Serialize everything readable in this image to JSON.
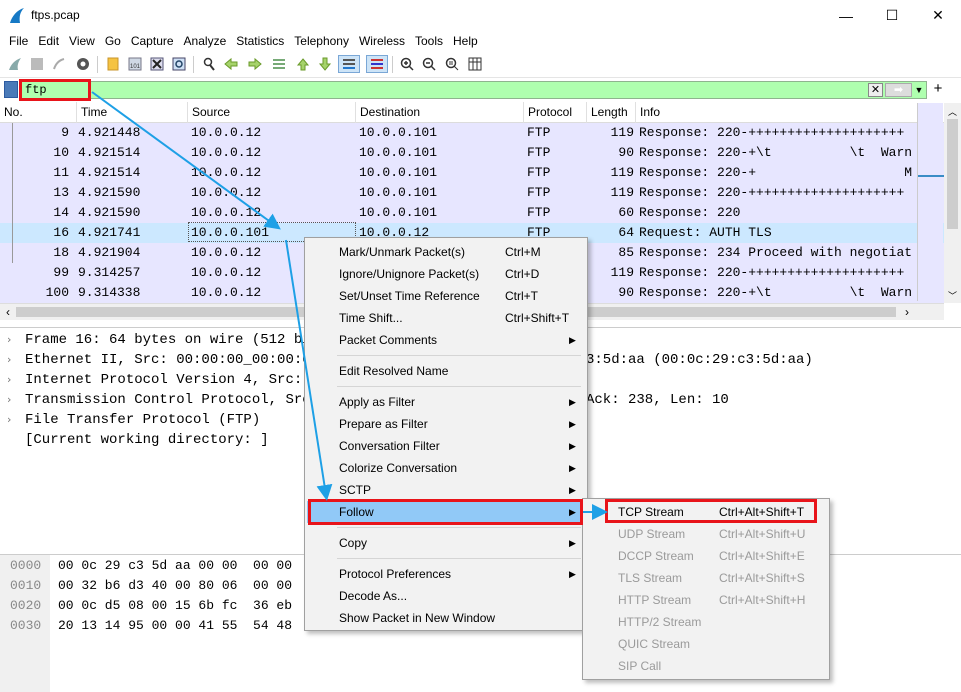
{
  "window": {
    "title": "ftps.pcap",
    "minimize": "—",
    "maximize": "☐",
    "close": "✕"
  },
  "menubar": [
    "File",
    "Edit",
    "View",
    "Go",
    "Capture",
    "Analyze",
    "Statistics",
    "Telephony",
    "Wireless",
    "Tools",
    "Help"
  ],
  "filter": {
    "value": "ftp",
    "plus": "+"
  },
  "columns": [
    "No.",
    "Time",
    "Source",
    "Destination",
    "Protocol",
    "Length",
    "Info"
  ],
  "packets": [
    {
      "no": "9",
      "time": "4.921448",
      "src": "10.0.0.12",
      "dst": "10.0.0.101",
      "proto": "FTP",
      "len": "119",
      "info": "Response: 220-++++++++++++++++++++"
    },
    {
      "no": "10",
      "time": "4.921514",
      "src": "10.0.0.12",
      "dst": "10.0.0.101",
      "proto": "FTP",
      "len": "90",
      "info": "Response: 220-+\\t          \\t  Warn"
    },
    {
      "no": "11",
      "time": "4.921514",
      "src": "10.0.0.12",
      "dst": "10.0.0.101",
      "proto": "FTP",
      "len": "119",
      "info": "Response: 220-+                   M"
    },
    {
      "no": "13",
      "time": "4.921590",
      "src": "10.0.0.12",
      "dst": "10.0.0.101",
      "proto": "FTP",
      "len": "119",
      "info": "Response: 220-++++++++++++++++++++"
    },
    {
      "no": "14",
      "time": "4.921590",
      "src": "10.0.0.12",
      "dst": "10.0.0.101",
      "proto": "FTP",
      "len": "60",
      "info": "Response: 220"
    },
    {
      "no": "16",
      "time": "4.921741",
      "src": "10.0.0.101",
      "dst": "10.0.0.12",
      "proto": "FTP",
      "len": "64",
      "info": "Request: AUTH TLS"
    },
    {
      "no": "18",
      "time": "4.921904",
      "src": "10.0.0.12",
      "dst": "",
      "proto": "",
      "len": "85",
      "info": "Response: 234 Proceed with negotiat"
    },
    {
      "no": "99",
      "time": "9.314257",
      "src": "10.0.0.12",
      "dst": "",
      "proto": "",
      "len": "119",
      "info": "Response: 220-++++++++++++++++++++"
    },
    {
      "no": "100",
      "time": "9.314338",
      "src": "10.0.0.12",
      "dst": "",
      "proto": "",
      "len": "90",
      "info": "Response: 220-+\\t          \\t  Warn"
    }
  ],
  "details": [
    {
      "text": "Frame 16: 64 bytes on wire (512 bit",
      "right": "",
      "expand": true
    },
    {
      "text": "Ethernet II, Src: 00:00:00_00:00:01",
      "right": "3:5d:aa (00:0c:29:c3:5d:aa)",
      "expand": true
    },
    {
      "text": "Internet Protocol Version 4, Src: 1",
      "right": "",
      "expand": true
    },
    {
      "text": "Transmission Control Protocol, Src",
      "right": "Ack: 238, Len: 10",
      "expand": true
    },
    {
      "text": "File Transfer Protocol (FTP)",
      "right": "",
      "expand": true
    },
    {
      "text": "[Current working directory: ]",
      "right": "",
      "expand": false
    }
  ],
  "bytes": [
    {
      "off": "0000",
      "hex": "00 0c 29 c3 5d aa 00 00  00 00"
    },
    {
      "off": "0010",
      "hex": "00 32 b6 d3 40 00 80 06  00 00"
    },
    {
      "off": "0020",
      "hex": "00 0c d5 08 00 15 6b fc  36 eb"
    },
    {
      "off": "0030",
      "hex": "20 13 14 95 00 00 41 55  54 48"
    }
  ],
  "context_menu": [
    {
      "label": "Mark/Unmark Packet(s)",
      "shortcut": "Ctrl+M"
    },
    {
      "label": "Ignore/Unignore Packet(s)",
      "shortcut": "Ctrl+D"
    },
    {
      "label": "Set/Unset Time Reference",
      "shortcut": "Ctrl+T"
    },
    {
      "label": "Time Shift...",
      "shortcut": "Ctrl+Shift+T"
    },
    {
      "label": "Packet Comments",
      "sub": "▶"
    },
    {
      "label": "Edit Resolved Name"
    },
    {
      "label": "Apply as Filter",
      "sub": "▶"
    },
    {
      "label": "Prepare as Filter",
      "sub": "▶"
    },
    {
      "label": "Conversation Filter",
      "sub": "▶"
    },
    {
      "label": "Colorize Conversation",
      "sub": "▶"
    },
    {
      "label": "SCTP",
      "sub": "▶"
    },
    {
      "label": "Follow",
      "sub": "▶"
    },
    {
      "label": "Copy",
      "sub": "▶"
    },
    {
      "label": "Protocol Preferences",
      "sub": "▶"
    },
    {
      "label": "Decode As..."
    },
    {
      "label": "Show Packet in New Window"
    }
  ],
  "follow_submenu": [
    {
      "label": "TCP Stream",
      "shortcut": "Ctrl+Alt+Shift+T",
      "enabled": true
    },
    {
      "label": "UDP Stream",
      "shortcut": "Ctrl+Alt+Shift+U",
      "enabled": false
    },
    {
      "label": "DCCP Stream",
      "shortcut": "Ctrl+Alt+Shift+E",
      "enabled": false
    },
    {
      "label": "TLS Stream",
      "shortcut": "Ctrl+Alt+Shift+S",
      "enabled": false
    },
    {
      "label": "HTTP Stream",
      "shortcut": "Ctrl+Alt+Shift+H",
      "enabled": false
    },
    {
      "label": "HTTP/2 Stream",
      "shortcut": "",
      "enabled": false
    },
    {
      "label": "QUIC Stream",
      "shortcut": "",
      "enabled": false
    },
    {
      "label": "SIP Call",
      "shortcut": "",
      "enabled": false
    }
  ],
  "colors": {
    "packet_row": "#e7e6ff",
    "selected_row": "#cce8ff",
    "filter_ok": "#afffaf",
    "highlight": "#91c9f7",
    "annotation_red": "#e8141a",
    "annotation_arrow": "#1ea0e6"
  }
}
